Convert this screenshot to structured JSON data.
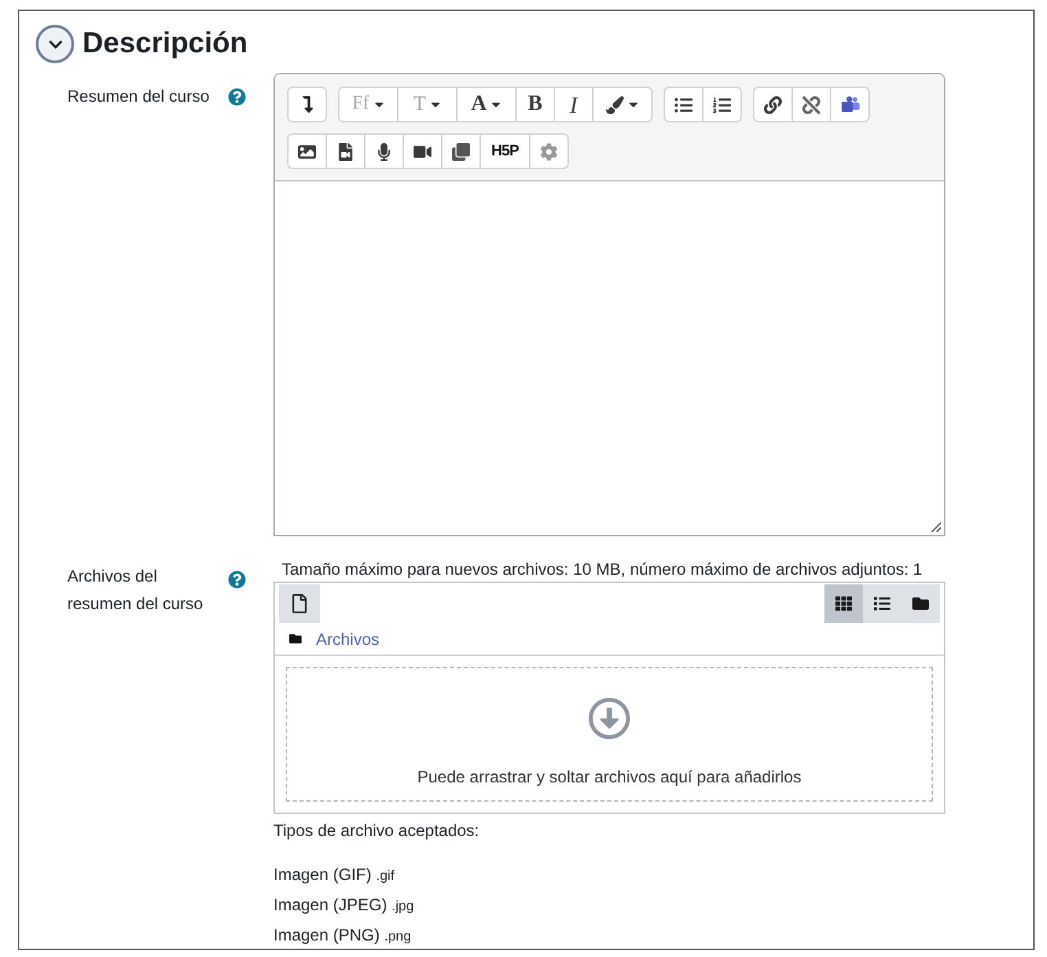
{
  "section": {
    "title": "Descripción",
    "expanded": true
  },
  "summary": {
    "label": "Resumen del curso",
    "help": true,
    "toolbar_rows": [
      [
        [
          {
            "kind": "more",
            "dropdown": false
          }
        ],
        [
          {
            "kind": "font-family",
            "label": "Ff",
            "dropdown": true
          },
          {
            "kind": "font-size",
            "label": "T",
            "dropdown": true
          },
          {
            "kind": "font-color",
            "label": "A",
            "dropdown": true
          },
          {
            "kind": "bold",
            "label": "B",
            "dropdown": false
          },
          {
            "kind": "italic",
            "label": "I",
            "dropdown": false
          },
          {
            "kind": "brush",
            "dropdown": true
          }
        ],
        [
          {
            "kind": "bullet-list",
            "dropdown": false
          },
          {
            "kind": "numbered-list",
            "dropdown": false
          }
        ],
        [
          {
            "kind": "link",
            "dropdown": false
          },
          {
            "kind": "unlink",
            "dropdown": false
          },
          {
            "kind": "teams",
            "dropdown": false
          }
        ]
      ],
      [
        [
          {
            "kind": "image",
            "dropdown": false
          },
          {
            "kind": "media",
            "dropdown": false
          },
          {
            "kind": "microphone",
            "dropdown": false
          },
          {
            "kind": "video",
            "dropdown": false
          },
          {
            "kind": "manage-files",
            "dropdown": false
          },
          {
            "kind": "h5p",
            "label": "H5P",
            "dropdown": false
          },
          {
            "kind": "accessibility",
            "dropdown": false
          }
        ]
      ]
    ]
  },
  "files": {
    "label": "Archivos del resumen del curso",
    "help": true,
    "limits": "Tamaño máximo para nuevos archivos: 10 MB, número máximo de archivos adjuntos: 1",
    "views": [
      {
        "kind": "icons",
        "selected": true
      },
      {
        "kind": "list",
        "selected": false
      },
      {
        "kind": "tree",
        "selected": false
      }
    ],
    "path": "Archivos",
    "dropzone": "Puede arrastrar y soltar archivos aquí para añadirlos"
  },
  "accepted_types": {
    "title": "Tipos de archivo aceptados:",
    "items": [
      {
        "name": "Imagen (GIF)",
        "ext": ".gif"
      },
      {
        "name": "Imagen (JPEG)",
        "ext": ".jpg"
      },
      {
        "name": "Imagen (PNG)",
        "ext": ".png"
      }
    ]
  }
}
